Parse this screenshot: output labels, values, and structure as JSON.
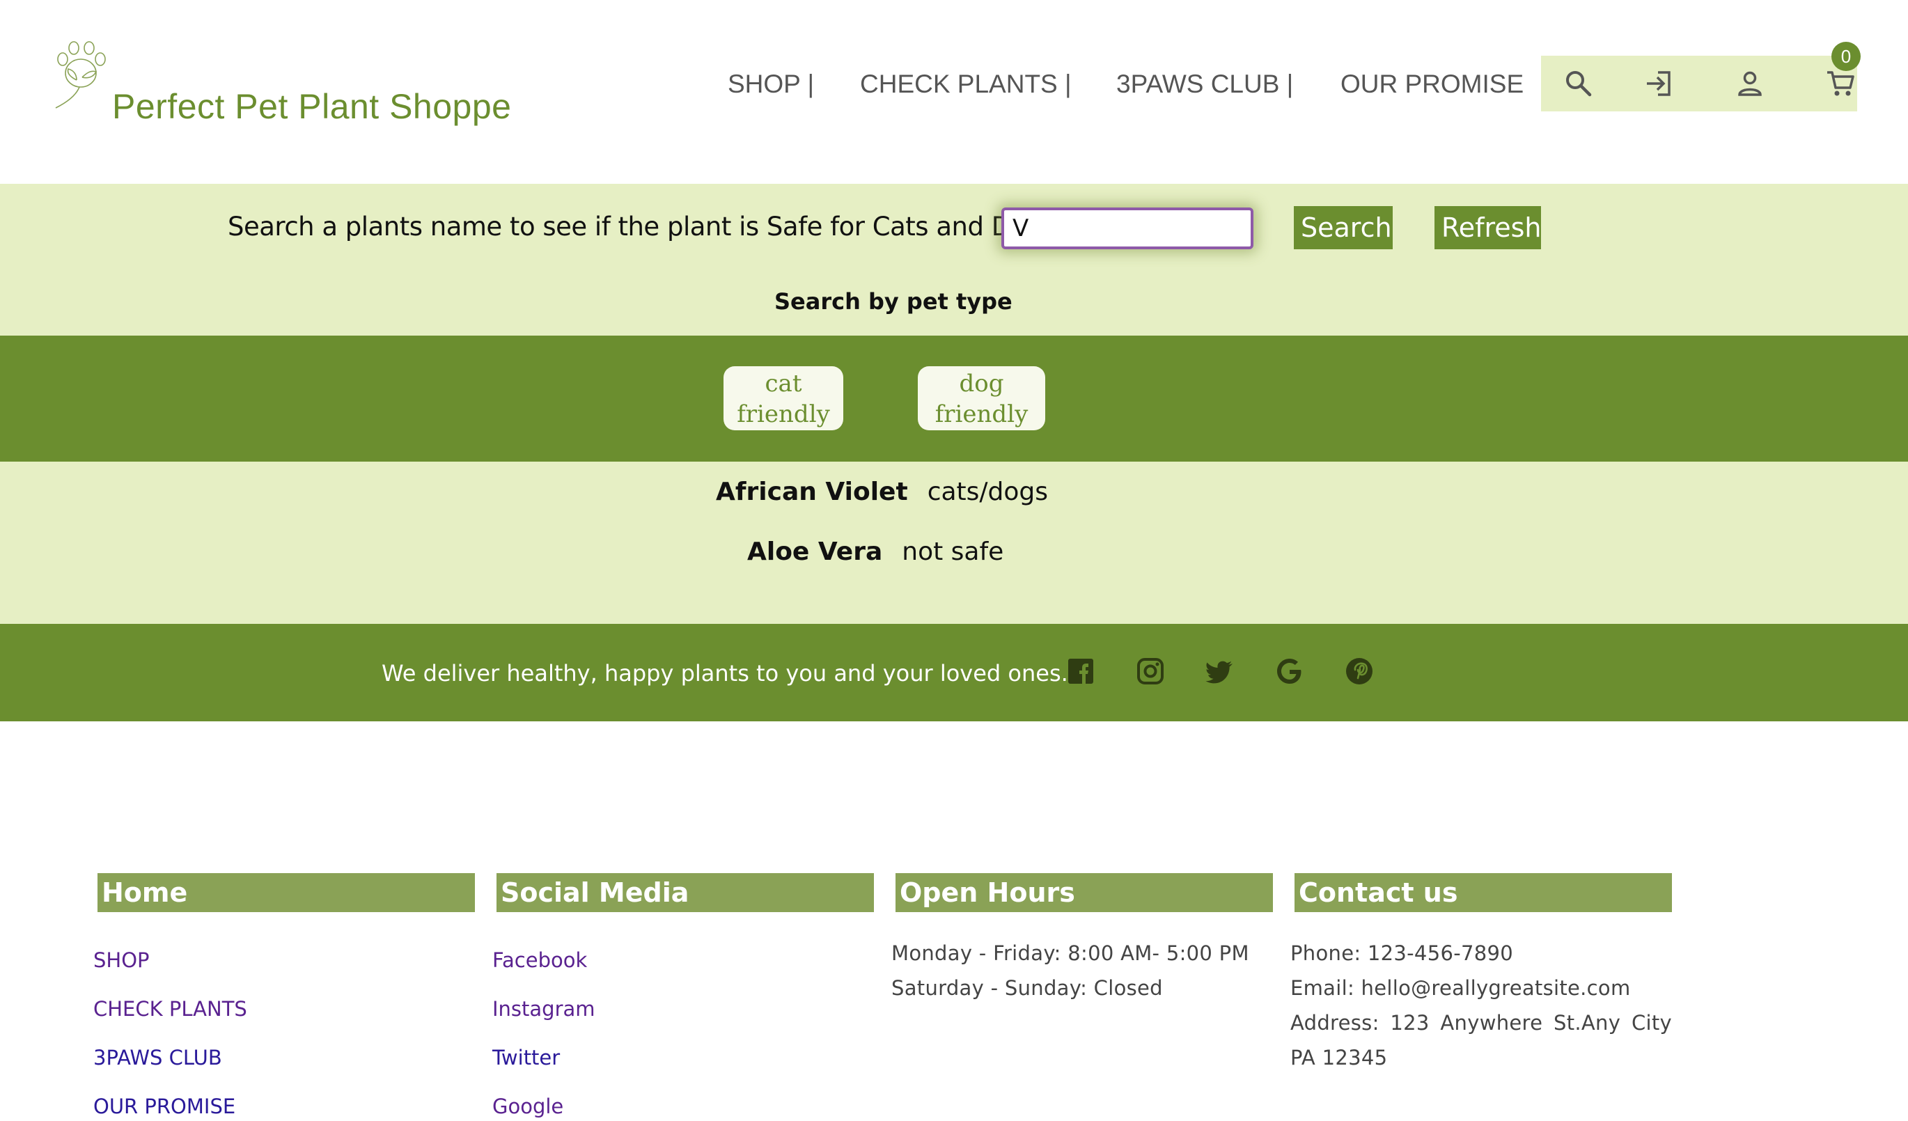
{
  "header": {
    "brand": "Perfect Pet Plant Shoppe",
    "nav": [
      "SHOP |",
      "CHECK PLANTS |",
      "3PAWS CLUB |",
      "OUR PROMISE"
    ],
    "icons": [
      "search-icon",
      "login-icon",
      "account-icon",
      "cart-icon"
    ],
    "cart_count": "0"
  },
  "search": {
    "prompt": "Search a plants name to see if the plant is Safe for Cats and Dogs",
    "input_value": "V",
    "search_label": "Search",
    "refresh_label": "Refresh",
    "pet_type_label": "Search by pet type"
  },
  "pet_filters": {
    "cat_line1": "cat",
    "cat_line2": "friendly",
    "dog_line1": "dog",
    "dog_line2": "friendly"
  },
  "results": [
    {
      "plant": "African Violet",
      "safety": "cats/dogs"
    },
    {
      "plant": "Aloe Vera",
      "safety": "not safe"
    }
  ],
  "tagline": {
    "text": "We deliver healthy, happy plants to you and your loved ones.",
    "icons": [
      "facebook-icon",
      "instagram-icon",
      "twitter-icon",
      "google-icon",
      "pinterest-icon"
    ]
  },
  "footer": {
    "home": {
      "heading": "Home",
      "links": [
        "SHOP",
        "CHECK PLANTS",
        "3PAWS CLUB",
        "OUR PROMISE"
      ]
    },
    "social": {
      "heading": "Social Media",
      "links": [
        "Facebook",
        "Instagram",
        "Twitter",
        "Google"
      ]
    },
    "hours": {
      "heading": "Open Hours",
      "line1": "Monday - Friday: 8:00 AM- 5:00 PM",
      "line2": "Saturday - Sunday: Closed"
    },
    "contact": {
      "heading": "Contact us",
      "phone": "Phone: 123-456-7890",
      "email": "Email: hello@reallygreatsite.com",
      "address": "Address: 123 Anywhere St.Any City PA 12345"
    }
  },
  "colors": {
    "brand_green": "#6b8e2f",
    "light_green": "#e6efc4",
    "footer_head": "#8aa256"
  }
}
